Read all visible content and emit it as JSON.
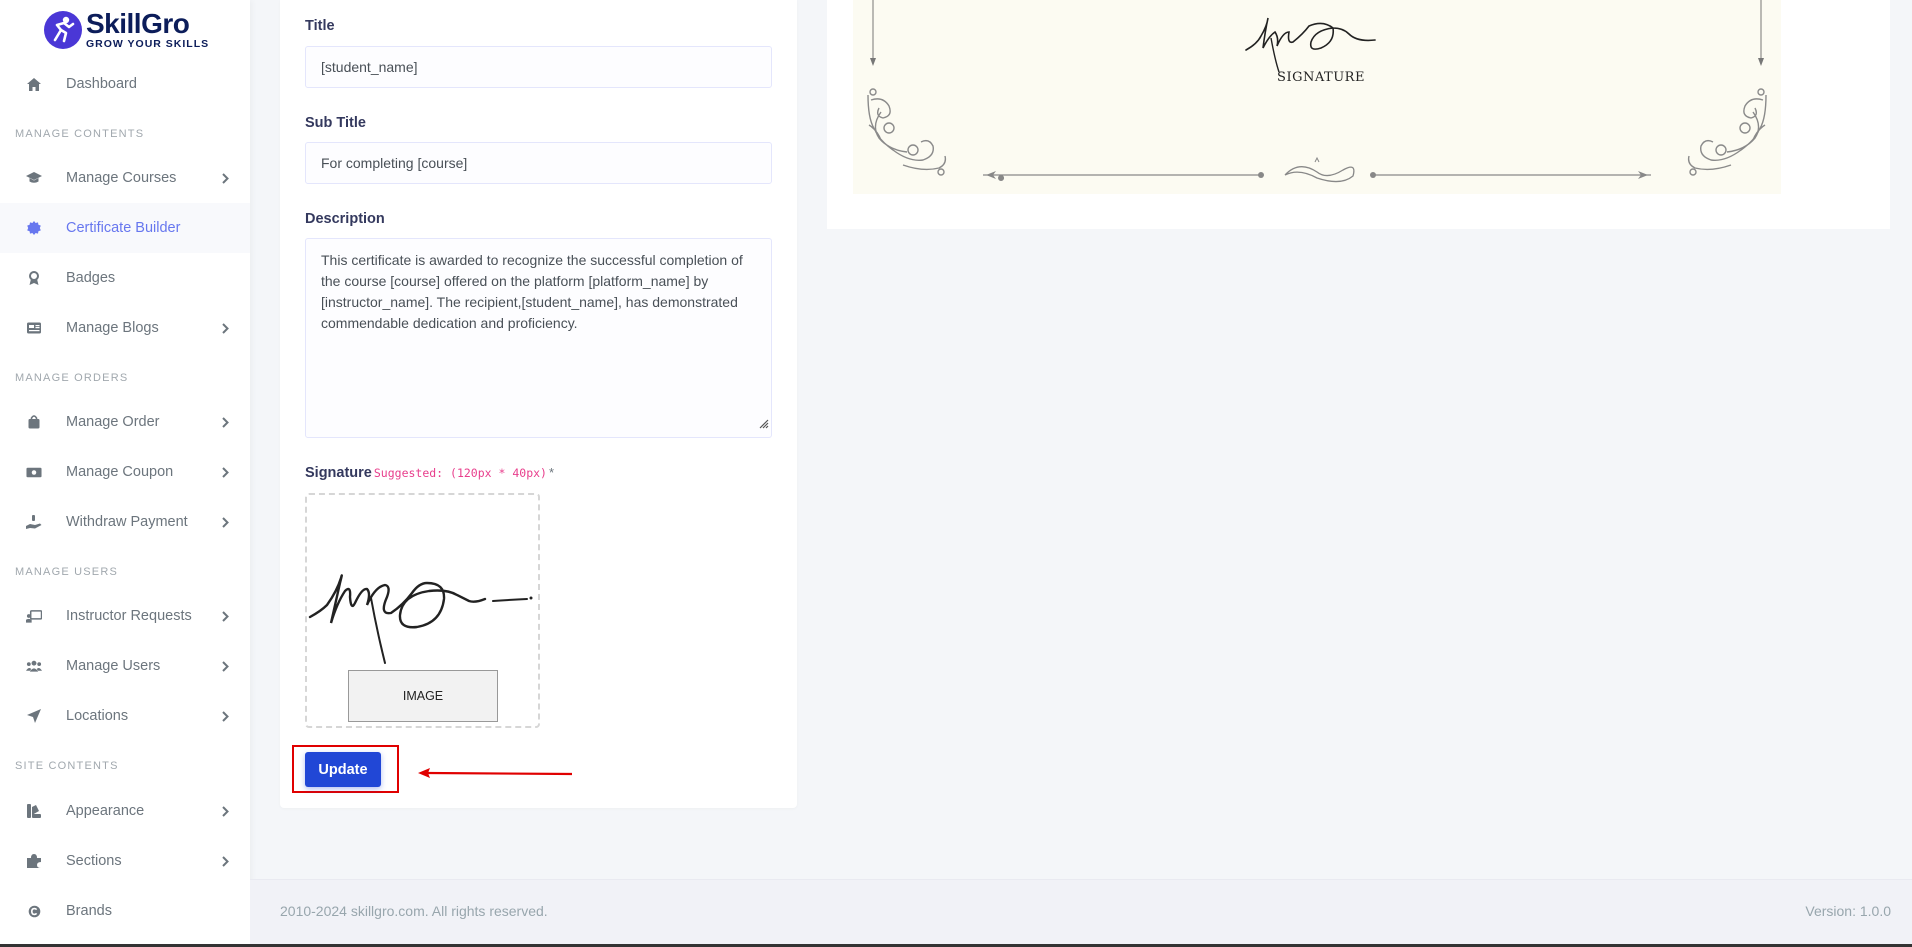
{
  "brand": {
    "name": "SkillGro",
    "tagline": "GROW YOUR SKILLS"
  },
  "sidebar": {
    "items": [
      {
        "label": "Dashboard",
        "icon": "home-icon",
        "active": false,
        "has_children": false
      },
      {
        "header": "MANAGE CONTENTS"
      },
      {
        "label": "Manage Courses",
        "icon": "graduation-cap-icon",
        "active": false,
        "has_children": true
      },
      {
        "label": "Certificate Builder",
        "icon": "certificate-icon",
        "active": true,
        "has_children": false
      },
      {
        "label": "Badges",
        "icon": "award-icon",
        "active": false,
        "has_children": false
      },
      {
        "label": "Manage Blogs",
        "icon": "newspaper-icon",
        "active": false,
        "has_children": true
      },
      {
        "header": "MANAGE ORDERS"
      },
      {
        "label": "Manage Order",
        "icon": "shopping-bag-icon",
        "active": false,
        "has_children": true
      },
      {
        "label": "Manage Coupon",
        "icon": "money-bill-icon",
        "active": false,
        "has_children": true
      },
      {
        "label": "Withdraw Payment",
        "icon": "hand-holding-dollar-icon",
        "active": false,
        "has_children": true
      },
      {
        "header": "MANAGE USERS"
      },
      {
        "label": "Instructor Requests",
        "icon": "chalkboard-user-icon",
        "active": false,
        "has_children": true
      },
      {
        "label": "Manage Users",
        "icon": "users-icon",
        "active": false,
        "has_children": true
      },
      {
        "label": "Locations",
        "icon": "location-arrow-icon",
        "active": false,
        "has_children": true
      },
      {
        "header": "SITE CONTENTS"
      },
      {
        "label": "Appearance",
        "icon": "paint-icon",
        "active": false,
        "has_children": true
      },
      {
        "label": "Sections",
        "icon": "puzzle-icon",
        "active": false,
        "has_children": true
      },
      {
        "label": "Brands",
        "icon": "copyright-icon",
        "active": false,
        "has_children": false
      }
    ]
  },
  "form": {
    "title_label": "Title",
    "title_value": "[student_name]",
    "subtitle_label": "Sub Title",
    "subtitle_value": "For completing [course]",
    "description_label": "Description",
    "description_value": "This certificate is awarded to recognize the successful completion of the course [course] offered on the platform [platform_name] by [instructor_name]. The recipient,[student_name], has demonstrated commendable dedication and proficiency.",
    "signature_label": "Signature",
    "signature_hint": "Suggested: (120px * 40px)",
    "signature_required": "*",
    "image_button": "IMAGE",
    "update_button": "Update"
  },
  "preview": {
    "signature_caption": "SIGNATURE"
  },
  "footer": {
    "copyright": "2010-2024 skillgro.com. All rights reserved.",
    "version": "Version: 1.0.0"
  },
  "colors": {
    "accent": "#6777ef",
    "primary_button": "#2147d6",
    "highlight": "#e00000",
    "hint": "#e83e8c"
  }
}
